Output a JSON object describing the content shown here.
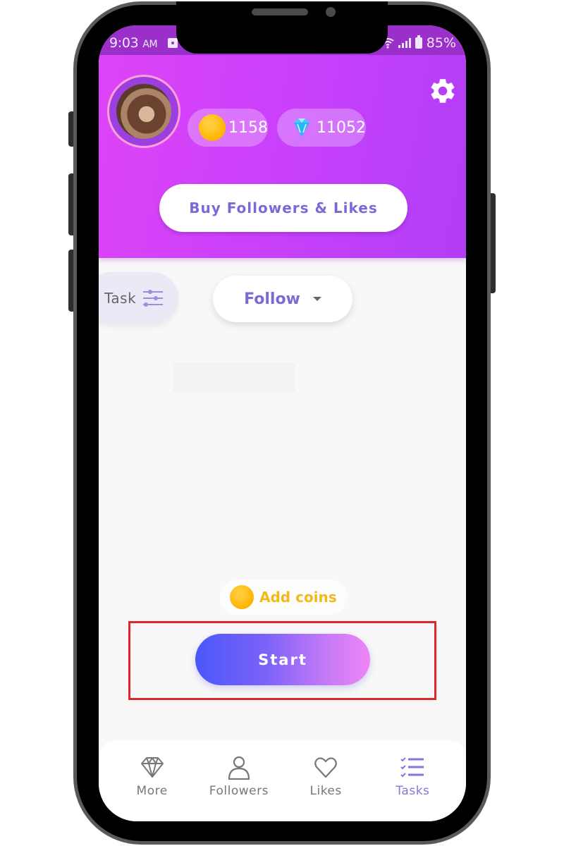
{
  "status_bar": {
    "time": "9:03",
    "ampm": "AM",
    "battery": "85%"
  },
  "header": {
    "coins": "1158",
    "gems": "11052",
    "buy_button_label": "Buy Followers & Likes"
  },
  "task_bar": {
    "task_label": "Task",
    "dropdown_selected": "Follow"
  },
  "actions": {
    "add_coins_label": "Add coins",
    "start_label": "Start"
  },
  "bottom_nav": {
    "items": [
      {
        "label": "More",
        "icon": "diamond-icon"
      },
      {
        "label": "Followers",
        "icon": "person-icon"
      },
      {
        "label": "Likes",
        "icon": "heart-icon"
      },
      {
        "label": "Tasks",
        "icon": "checklist-icon",
        "active": true
      }
    ]
  },
  "colors": {
    "header_gradient_start": "#dd45f7",
    "header_gradient_end": "#b23ef6",
    "accent_text": "#7a6ad8",
    "start_gradient_start": "#4a57fb",
    "start_gradient_end": "#ee86f6",
    "highlight_border": "#e0262a",
    "coin_gold": "#f5b81a"
  }
}
